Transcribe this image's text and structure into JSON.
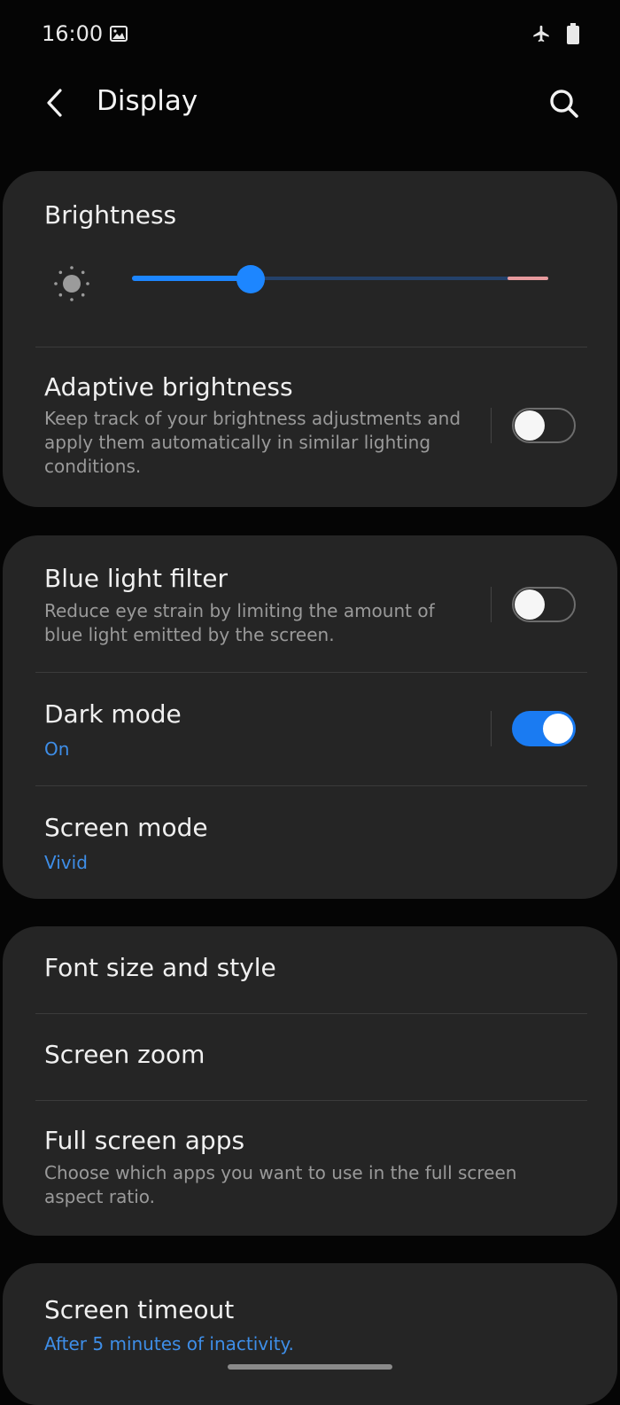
{
  "status_bar": {
    "time": "16:00",
    "icons": [
      "image-icon",
      "airplane-icon",
      "battery-icon"
    ]
  },
  "header": {
    "title": "Display",
    "back_icon": "chevron-left-icon",
    "search_icon": "search-icon"
  },
  "brightness": {
    "title": "Brightness",
    "level": 0.285,
    "icon": "sun-icon"
  },
  "adaptive_brightness": {
    "title": "Adaptive brightness",
    "description": "Keep track of your brightness adjustments and apply them automatically in similar lighting conditions.",
    "enabled": false
  },
  "blue_light_filter": {
    "title": "Blue light filter",
    "description": "Reduce eye strain by limiting the amount of blue light emitted by the screen.",
    "enabled": false
  },
  "dark_mode": {
    "title": "Dark mode",
    "value": "On",
    "enabled": true
  },
  "screen_mode": {
    "title": "Screen mode",
    "value": "Vivid"
  },
  "font_size_style": {
    "title": "Font size and style"
  },
  "screen_zoom": {
    "title": "Screen zoom"
  },
  "full_screen_apps": {
    "title": "Full screen apps",
    "description": "Choose which apps you want to use in the full screen aspect ratio."
  },
  "screen_timeout": {
    "title": "Screen timeout",
    "value": "After 5 minutes of inactivity."
  },
  "colors": {
    "accent": "#1d86ff",
    "card": "#252525",
    "background": "#050505",
    "value_text": "#3e8ee8"
  }
}
